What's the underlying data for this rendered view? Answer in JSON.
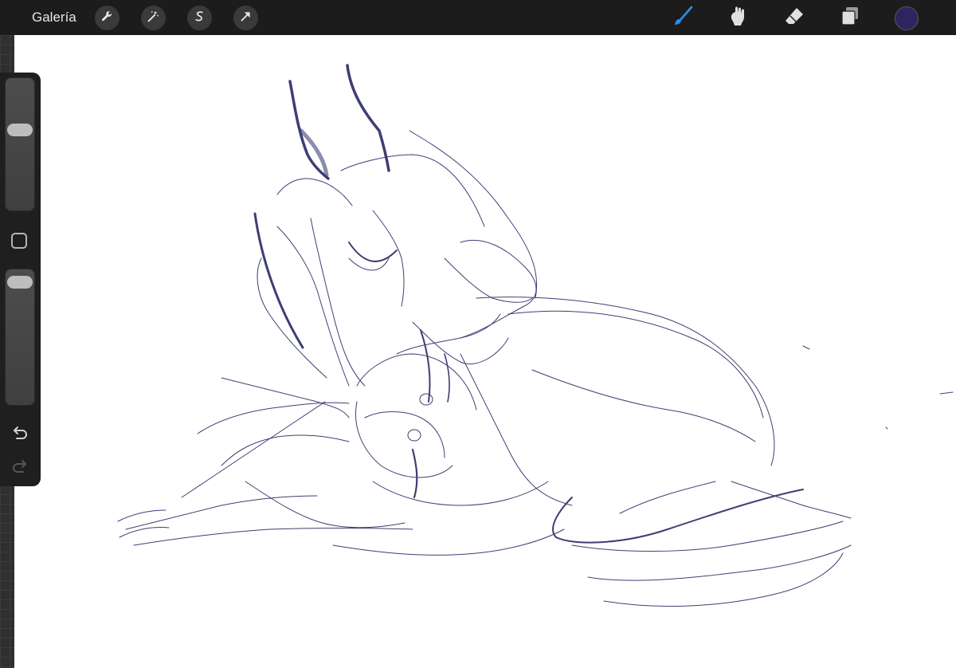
{
  "topbar": {
    "gallery_label": "Galería",
    "left_tools": [
      {
        "name": "wrench-icon",
        "tool": "actions"
      },
      {
        "name": "magic-wand-icon",
        "tool": "adjustments"
      },
      {
        "name": "selection-s-icon",
        "tool": "selection"
      },
      {
        "name": "transform-arrow-icon",
        "tool": "transform"
      }
    ],
    "right_tools": [
      {
        "name": "brush-icon",
        "tool": "paint",
        "active": true
      },
      {
        "name": "smudge-icon",
        "tool": "smudge",
        "active": false
      },
      {
        "name": "eraser-icon",
        "tool": "erase",
        "active": false
      },
      {
        "name": "layers-icon",
        "tool": "layers",
        "active": false
      }
    ],
    "current_color": "#2e2560",
    "active_tool_color": "#2f8cf0"
  },
  "sidebar": {
    "brush_size_level": 0.62,
    "opacity_level": 0.96,
    "buttons": [
      "modify-square-button",
      "undo-button",
      "redo-button"
    ]
  },
  "canvas": {
    "stroke_color": "#2a2a66",
    "background": "#ffffff"
  }
}
